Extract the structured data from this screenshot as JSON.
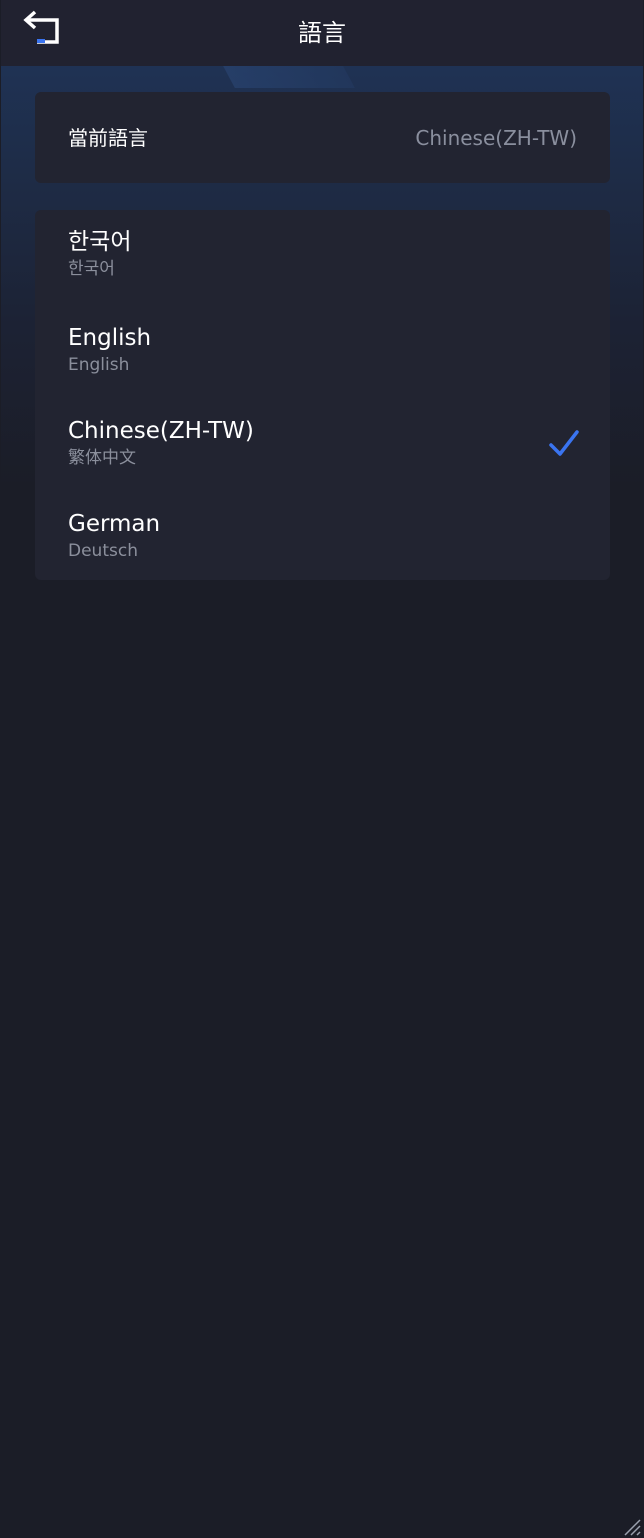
{
  "header": {
    "title": "語言",
    "back_icon": "back-arrow-icon"
  },
  "current": {
    "label": "當前語言",
    "value": "Chinese(ZH-TW)"
  },
  "languages": [
    {
      "name": "한국어",
      "native": "한국어",
      "selected": false
    },
    {
      "name": "English",
      "native": "English",
      "selected": false
    },
    {
      "name": "Chinese(ZH-TW)",
      "native": "繁体中文",
      "selected": true
    },
    {
      "name": "German",
      "native": "Deutsch",
      "selected": false
    }
  ],
  "colors": {
    "background": "#1b1d27",
    "topbar": "#212230",
    "card": "#222431",
    "accent": "#3a74f0",
    "muted_text": "#8a8f9e"
  }
}
